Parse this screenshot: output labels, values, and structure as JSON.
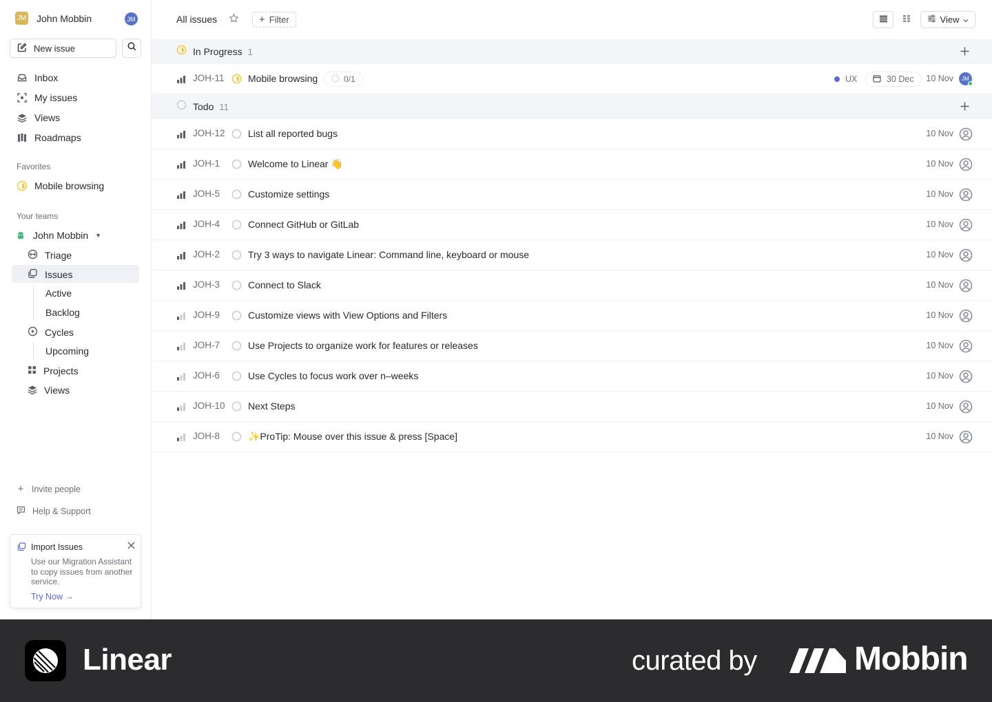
{
  "workspace": {
    "initials": "JM",
    "name": "John Mobbin",
    "user_initials": "JM"
  },
  "sidebar": {
    "new_issue": "New issue",
    "nav": [
      {
        "label": "Inbox",
        "icon": "inbox-icon"
      },
      {
        "label": "My issues",
        "icon": "my-issues-icon"
      },
      {
        "label": "Views",
        "icon": "views-icon"
      },
      {
        "label": "Roadmaps",
        "icon": "roadmaps-icon"
      }
    ],
    "favorites_label": "Favorites",
    "favorites": [
      {
        "label": "Mobile browsing",
        "icon": "in-progress-icon"
      }
    ],
    "teams_label": "Your teams",
    "team": {
      "name": "John Mobbin"
    },
    "team_items": {
      "triage": "Triage",
      "issues": "Issues",
      "active": "Active",
      "backlog": "Backlog",
      "cycles": "Cycles",
      "upcoming": "Upcoming",
      "projects": "Projects",
      "views": "Views"
    },
    "invite": "Invite people",
    "help": "Help & Support",
    "import": {
      "title": "Import Issues",
      "description": "Use our Migration Assistant to copy issues from another service.",
      "link": "Try Now →"
    }
  },
  "header": {
    "title": "All issues",
    "filter": "Filter",
    "view": "View"
  },
  "groups": {
    "in_progress": {
      "name": "In Progress",
      "count": "1"
    },
    "todo": {
      "name": "Todo",
      "count": "11"
    }
  },
  "in_progress_issue": {
    "id": "JOH-11",
    "title": "Mobile browsing",
    "sub_issues": "0/1",
    "label": "UX",
    "label_color": "#5e6ad2",
    "due": "30 Dec",
    "date": "10 Nov",
    "assignee": "JM"
  },
  "todo_issues": [
    {
      "id": "JOH-12",
      "title": "List all reported bugs",
      "date": "10 Nov"
    },
    {
      "id": "JOH-1",
      "title": "Welcome to Linear 👋",
      "date": "10 Nov"
    },
    {
      "id": "JOH-5",
      "title": "Customize settings",
      "date": "10 Nov"
    },
    {
      "id": "JOH-4",
      "title": "Connect GitHub or GitLab",
      "date": "10 Nov"
    },
    {
      "id": "JOH-2",
      "title": "Try 3 ways to navigate Linear: Command line, keyboard or mouse",
      "date": "10 Nov"
    },
    {
      "id": "JOH-3",
      "title": "Connect to Slack",
      "date": "10 Nov"
    },
    {
      "id": "JOH-9",
      "title": "Customize views with View Options and Filters",
      "date": "10 Nov"
    },
    {
      "id": "JOH-7",
      "title": "Use Projects to organize work for features or releases",
      "date": "10 Nov"
    },
    {
      "id": "JOH-6",
      "title": "Use Cycles to focus work over n–weeks",
      "date": "10 Nov"
    },
    {
      "id": "JOH-10",
      "title": "Next Steps",
      "date": "10 Nov"
    },
    {
      "id": "JOH-8",
      "title": "✨ProTip: Mouse over this issue & press [Space]",
      "date": "10 Nov"
    }
  ],
  "banner": {
    "app": "Linear",
    "curated": "curated by",
    "brand": "Mobbin"
  },
  "colors": {
    "accent": "#5e6ad2",
    "in_progress": "#f2c94c",
    "banner_bg": "#2c2c2e"
  }
}
